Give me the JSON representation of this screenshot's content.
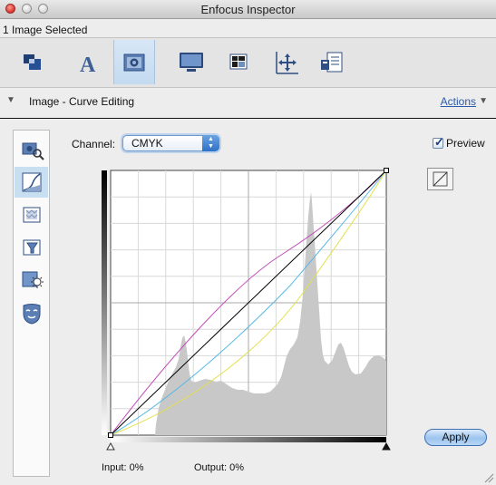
{
  "window": {
    "title": "Enfocus Inspector"
  },
  "selection": {
    "count_text": "1 Image Selected"
  },
  "toolbar": {
    "icons": [
      "object-icon",
      "text-icon",
      "image-icon",
      "monitor-icon",
      "color-icon",
      "position-icon",
      "document-icon"
    ],
    "active_index": 2
  },
  "section": {
    "title": "Image - Curve Editing",
    "actions_label": "Actions"
  },
  "side_tools": {
    "icons": [
      "image-magnify-icon",
      "curve-icon",
      "pattern-icon",
      "filter-icon",
      "brightness-icon",
      "mask-icon"
    ],
    "active_index": 1
  },
  "channel": {
    "label": "Channel:",
    "value": "CMYK"
  },
  "preview": {
    "label": "Preview",
    "checked": true
  },
  "curve": {
    "curve_colors": {
      "magenta": "#c24bb8",
      "cyan": "#56b8e6",
      "yellow": "#e3e04a",
      "black": "#000000"
    }
  },
  "apply_label": "Apply",
  "readout": {
    "input_text": "Input:  0%",
    "output_text": "Output:  0%"
  }
}
